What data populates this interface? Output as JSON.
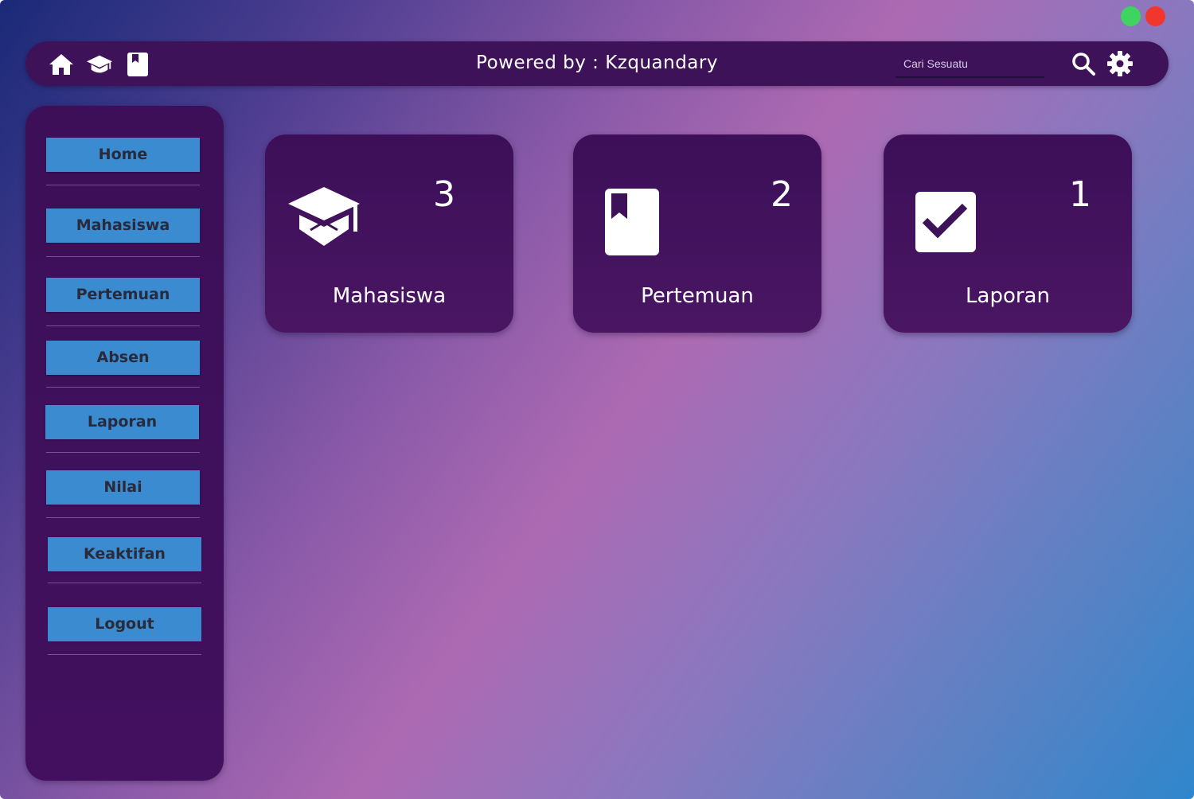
{
  "window": {
    "controls": [
      {
        "name": "maximize",
        "color": "#3fd45f"
      },
      {
        "name": "close",
        "color": "#f0362d"
      }
    ]
  },
  "topbar": {
    "title": "Powered by : Kzquandary",
    "icons": [
      "home-icon",
      "graduation-cap-icon",
      "book-icon"
    ],
    "search": {
      "placeholder": "Cari Sesuatu",
      "value": ""
    },
    "right_icons": [
      "search-icon",
      "gear-icon"
    ]
  },
  "sidebar": {
    "items": [
      {
        "label": "Home"
      },
      {
        "label": "Mahasiswa"
      },
      {
        "label": "Pertemuan"
      },
      {
        "label": "Absen"
      },
      {
        "label": "Laporan"
      },
      {
        "label": "Nilai"
      },
      {
        "label": "Keaktifan"
      },
      {
        "label": "Logout"
      }
    ]
  },
  "cards": [
    {
      "label": "Mahasiswa",
      "count": "3",
      "icon": "graduation-cap-icon"
    },
    {
      "label": "Pertemuan",
      "count": "2",
      "icon": "book-icon"
    },
    {
      "label": "Laporan",
      "count": "1",
      "icon": "checkbox-icon"
    }
  ],
  "colors": {
    "panel": "#3e1258",
    "nav_button": "#3a8bd0",
    "nav_text": "#2a2a3a",
    "text": "#ffffff"
  }
}
